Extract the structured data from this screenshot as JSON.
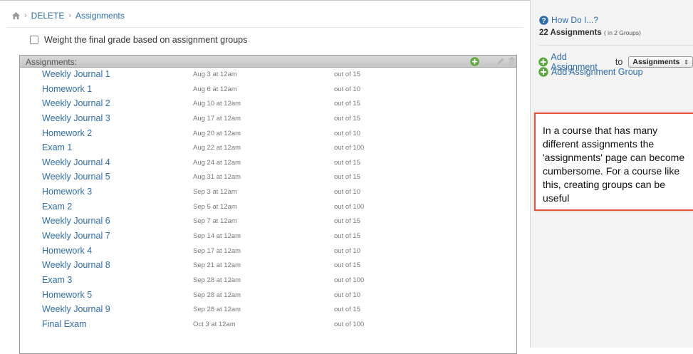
{
  "breadcrumb": {
    "items": [
      "DELETE",
      "Assignments"
    ]
  },
  "options": {
    "weight_label": "Weight the final grade based on assignment groups",
    "weight_checked": false
  },
  "group": {
    "title": "Assignments:"
  },
  "assignments": [
    {
      "name": "Weekly Journal 1",
      "due": "Aug 3 at 12am",
      "points": "out of 15"
    },
    {
      "name": "Homework 1",
      "due": "Aug 6 at 12am",
      "points": "out of 10"
    },
    {
      "name": "Weekly Journal 2",
      "due": "Aug 10 at 12am",
      "points": "out of 15"
    },
    {
      "name": "Weekly Journal 3",
      "due": "Aug 17 at 12am",
      "points": "out of 15"
    },
    {
      "name": "Homework 2",
      "due": "Aug 20 at 12am",
      "points": "out of 10"
    },
    {
      "name": "Exam 1",
      "due": "Aug 22 at 12am",
      "points": "out of 100"
    },
    {
      "name": "Weekly Journal 4",
      "due": "Aug 24 at 12am",
      "points": "out of 15"
    },
    {
      "name": "Weekly Journal 5",
      "due": "Aug 31 at 12am",
      "points": "out of 15"
    },
    {
      "name": "Homework 3",
      "due": "Sep 3 at 12am",
      "points": "out of 10"
    },
    {
      "name": "Exam 2",
      "due": "Sep 5 at 12am",
      "points": "out of 100"
    },
    {
      "name": "Weekly Journal 6",
      "due": "Sep 7 at 12am",
      "points": "out of 15"
    },
    {
      "name": "Weekly Journal 7",
      "due": "Sep 14 at 12am",
      "points": "out of 15"
    },
    {
      "name": "Homework 4",
      "due": "Sep 17 at 12am",
      "points": "out of 10"
    },
    {
      "name": "Weekly Journal 8",
      "due": "Sep 21 at 12am",
      "points": "out of 15"
    },
    {
      "name": "Exam 3",
      "due": "Sep 28 at 12am",
      "points": "out of 100"
    },
    {
      "name": "Homework 5",
      "due": "Sep 28 at 12am",
      "points": "out of 10"
    },
    {
      "name": "Weekly Journal 9",
      "due": "Sep 28 at 12am",
      "points": "out of 15"
    },
    {
      "name": "Final Exam",
      "due": "Oct 3 at 12am",
      "points": "out of 100"
    }
  ],
  "sidebar": {
    "help_label": "How Do I...?",
    "count_label": "22 Assignments",
    "count_sub": "( in 2 Groups)",
    "add_assignment_label": "Add Assignment",
    "to_label": "to",
    "group_select_value": "Assignments",
    "add_group_label": "Add Assignment Group"
  },
  "callout": {
    "text": "In a course that has many different assignments the 'assignments' page can become cumbersome. For a course like this, creating groups can be useful"
  },
  "colors": {
    "link": "#2e6dab",
    "add_green": "#5aa83a",
    "callout_border": "#e05440"
  }
}
